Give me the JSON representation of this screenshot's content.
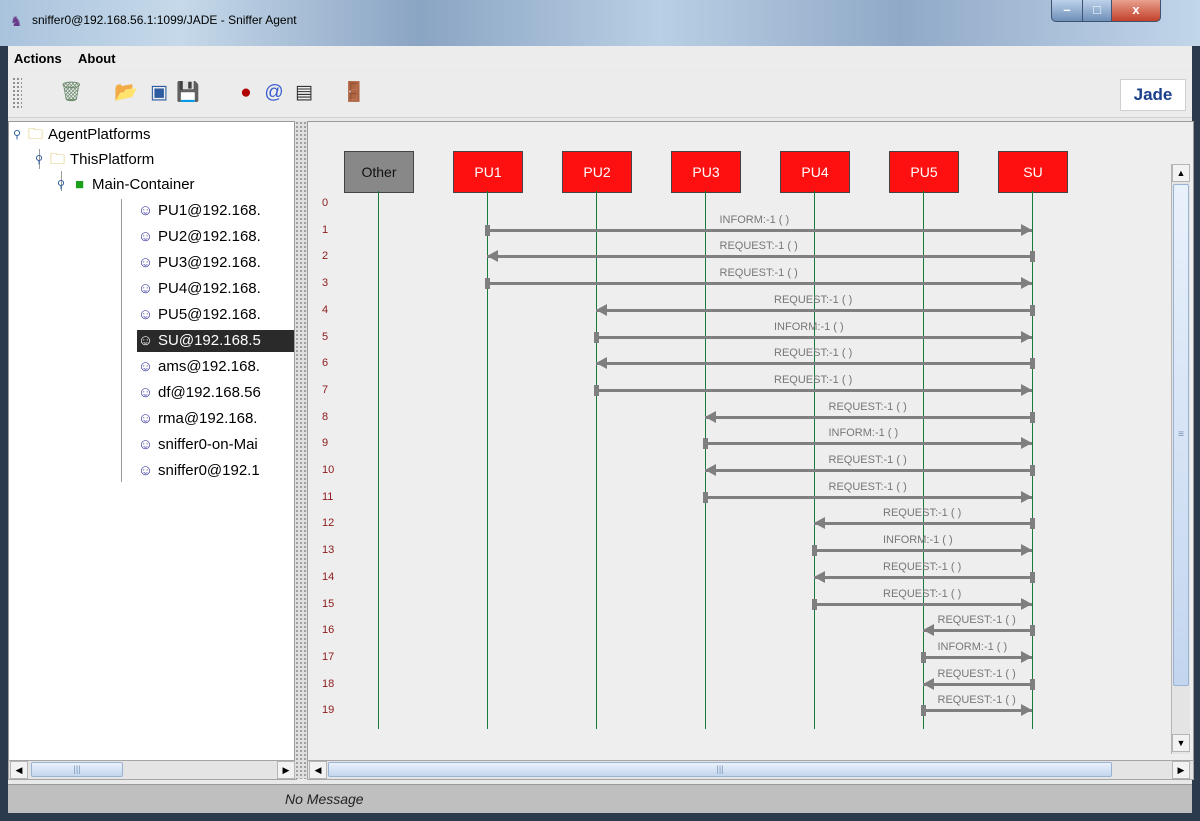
{
  "window": {
    "title": "sniffer0@192.168.56.1:1099/JADE - Sniffer Agent",
    "app_icon": "jade-agent-icon"
  },
  "window_controls": {
    "minimize": "–",
    "maximize": "□",
    "close": "x"
  },
  "menu": [
    "Actions",
    "About"
  ],
  "toolbar": {
    "icons": [
      "trash-icon",
      "open-folder-icon",
      "properties-icon",
      "save-icon",
      "record-icon",
      "sniff-icon",
      "filter-icon",
      "exit-door-icon"
    ],
    "logo_text": "Jade"
  },
  "tree": {
    "root": "AgentPlatforms",
    "platform": "ThisPlatform",
    "container": "Main-Container",
    "agents": [
      "PU1@192.168.",
      "PU2@192.168.",
      "PU3@192.168.",
      "PU4@192.168.",
      "PU5@192.168.",
      "SU@192.168.5",
      "ams@192.168.",
      "df@192.168.56",
      "rma@192.168.",
      "sniffer0-on-Mai",
      "sniffer0@192.1"
    ],
    "selected_index": 5
  },
  "diagram": {
    "agents": [
      "Other",
      "PU1",
      "PU2",
      "PU3",
      "PU4",
      "PU5",
      "SU"
    ],
    "line_numbers": [
      "0",
      "1",
      "2",
      "3",
      "4",
      "5",
      "6",
      "7",
      "8",
      "9",
      "10",
      "11",
      "12",
      "13",
      "14",
      "15",
      "16",
      "17",
      "18",
      "19"
    ],
    "messages": [
      {
        "label": "INFORM:-1 (         )",
        "from": "PU1",
        "to": "SU"
      },
      {
        "label": "REQUEST:-1 (       )",
        "from": "SU",
        "to": "PU1"
      },
      {
        "label": "REQUEST:-1 (       )",
        "from": "PU1",
        "to": "SU"
      },
      {
        "label": "REQUEST:-1 (       )",
        "from": "SU",
        "to": "PU2"
      },
      {
        "label": "INFORM:-1 (       )",
        "from": "PU2",
        "to": "SU"
      },
      {
        "label": "REQUEST:-1 (       )",
        "from": "SU",
        "to": "PU2"
      },
      {
        "label": "REQUEST:-1 (       )",
        "from": "PU2",
        "to": "SU"
      },
      {
        "label": "REQUEST:-1 (       )",
        "from": "SU",
        "to": "PU3"
      },
      {
        "label": "INFORM:-1 (       )",
        "from": "PU3",
        "to": "SU"
      },
      {
        "label": "REQUEST:-1 (       )",
        "from": "SU",
        "to": "PU3"
      },
      {
        "label": "REQUEST:-1 (       )",
        "from": "PU3",
        "to": "SU"
      },
      {
        "label": "REQUEST:-1 (       )",
        "from": "SU",
        "to": "PU4"
      },
      {
        "label": "INFORM:-1 (       )",
        "from": "PU4",
        "to": "SU"
      },
      {
        "label": "REQUEST:-1 (       )",
        "from": "SU",
        "to": "PU4"
      },
      {
        "label": "REQUEST:-1 (       )",
        "from": "PU4",
        "to": "SU"
      },
      {
        "label": "REQUEST:-1 (       )",
        "from": "SU",
        "to": "PU5"
      },
      {
        "label": "INFORM:-1 (       )",
        "from": "PU5",
        "to": "SU"
      },
      {
        "label": "REQUEST:-1 (       )",
        "from": "SU",
        "to": "PU5"
      },
      {
        "label": "REQUEST:-1 (       )",
        "from": "PU5",
        "to": "SU"
      }
    ]
  },
  "scrollbar": {
    "up": "▲",
    "down": "▼",
    "left": "◀",
    "right": "▶",
    "grip": "≡",
    "hgrip": "|||"
  },
  "status": {
    "text": "No Message"
  },
  "colors": {
    "agent_box": "#ff1010",
    "other_box": "#888888",
    "lifeline": "#1a7a3a",
    "message": "#7f7f7f",
    "line_number": "#8b1a1a"
  }
}
